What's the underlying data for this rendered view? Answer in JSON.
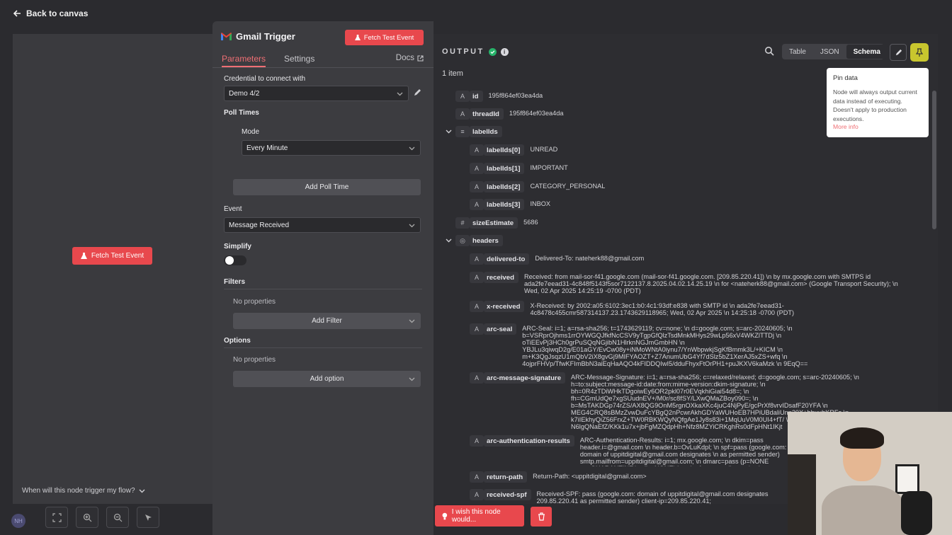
{
  "topbar": {
    "back_label": "Back to canvas"
  },
  "canvas": {
    "fetch_label": "Fetch Test Event",
    "trigger_question": "When will this node trigger my flow?",
    "avatar_initials": "NH"
  },
  "node": {
    "title": "Gmail Trigger",
    "fetch_label": "Fetch Test Event",
    "tabs": [
      {
        "label": "Parameters"
      },
      {
        "label": "Settings"
      }
    ],
    "docs_label": "Docs",
    "credential_label": "Credential to connect with",
    "credential_value": "Demo 4/2",
    "poll_times_label": "Poll Times",
    "mode_label": "Mode",
    "mode_value": "Every Minute",
    "add_poll_label": "Add Poll Time",
    "event_label": "Event",
    "event_value": "Message Received",
    "simplify_label": "Simplify",
    "simplify_on": false,
    "filters_label": "Filters",
    "filters_empty": "No properties",
    "add_filter_label": "Add Filter",
    "options_label": "Options",
    "options_empty": "No properties",
    "add_option_label": "Add option"
  },
  "output": {
    "title": "OUTPUT",
    "item_count": "1 item",
    "view_tabs": [
      {
        "label": "Table"
      },
      {
        "label": "JSON"
      },
      {
        "label": "Schema"
      }
    ],
    "active_view": "Schema",
    "tooltip": {
      "title": "Pin data",
      "body": "Node will always output current data instead of executing. Doesn't apply to production executions.",
      "link": "More info"
    },
    "rows": [
      {
        "type": "A",
        "key": "id",
        "value": "195f864ef03ea4da"
      },
      {
        "type": "A",
        "key": "threadId",
        "value": "195f864ef03ea4da"
      },
      {
        "type": "list",
        "key": "labelIds",
        "value": ""
      },
      {
        "type": "A",
        "key": "labelIds[0]",
        "value": "UNREAD"
      },
      {
        "type": "A",
        "key": "labelIds[1]",
        "value": "IMPORTANT"
      },
      {
        "type": "A",
        "key": "labelIds[2]",
        "value": "CATEGORY_PERSONAL"
      },
      {
        "type": "A",
        "key": "labelIds[3]",
        "value": "INBOX"
      },
      {
        "type": "#",
        "key": "sizeEstimate",
        "value": "5686"
      },
      {
        "type": "obj",
        "key": "headers",
        "value": ""
      },
      {
        "type": "A",
        "key": "delivered-to",
        "value": "Delivered-To: nateherk88@gmail.com"
      },
      {
        "type": "A",
        "key": "received",
        "value": "Received: from mail-sor-f41.google.com (mail-sor-f41.google.com. [209.85.220.41]) \\n by mx.google.com with SMTPS id ada2fe7eead31-4c848f5143f5sor7122137.8.2025.04.02.14.25.19 \\n for <nateherk88@gmail.com> (Google Transport Security); \\n Wed, 02 Apr 2025 14:25:19 -0700 (PDT)"
      },
      {
        "type": "A",
        "key": "x-received",
        "value": "X-Received: by 2002:a05:6102:3ec1:b0:4c1:93df:e838 with SMTP id \\n ada2fe7eead31-4c8478c455cmr587314137.23.1743629118965; Wed, 02 Apr 2025 \\n 14:25:18 -0700 (PDT)"
      },
      {
        "type": "A",
        "key": "arc-seal",
        "value": "ARC-Seal: i=1; a=rsa-sha256; t=1743629119; cv=none; \\n d=google.com; s=arc-20240605; \\n b=VSRprOjhms1rrOYWGQJfkfNcCSV9yTgpGfQlzTsdMnkMHys29wLp56xV4WKZlTTDj \\n oTiEEvPj3HCh0grPuSQqNGjibN1HlrknNGJmGmbHN \\n YBJLu3qiwqD2g/E01aGY/EvCw08y+iNMoWNtA0iynu7/YnWbpwkjSgKfBmmk3L/+KICM \\n m+K3QgJsqzU1mQbV2iX8gvGj9MIFYAOZT+Z7AnumUbG4Yf7dSlz5bZ1XerAJ5xZS+wfq \\n 4ojprFHVp/TfwKFImBbN3aiEqHaAQO4kFIDDQIwI5/dduFhyxFtOrPH1+puJKXV6kaMzk \\n 9EqQ=="
      },
      {
        "type": "A",
        "key": "arc-message-signature",
        "value": "ARC-Message-Signature: i=1; a=rsa-sha256; c=relaxed/relaxed; d=google.com; s=arc-20240605; \\n h=to:subject:message-id:date:from:mime-version:dkim-signature; \\n bh=0R4zTDiWHkTDgoiwEy6OR2pkl07r0EVqkhiGiai54d8=; \\n fh=CGmUdQe7xgSUudnEV+/M0r/sc8fSY/LXwQMaZBoy090=; \\n b=MsTAKDGp74rZS/AX8QG9OnM5rgnOXkaXKc4juC4NjPyE/gcPrXf8vrvIDsafF20YFA \\n MEG4CRQ8sBMzZvwDuFcYBgQ2nPcwrAkhGDYaWUHoEB7HPiUBdaliUnn20X+bhuubKRFs \\n k7iIEkhyQiZ56FrxZ+TW0RBKWQyNQfgAe1Jy8s83i+1MqUuV0M0UI4+fT/ \\n N6lgQNaEfZ/KKk1u7x+jbFgMZQdpHh+Nfz8MZYiCRKghRs0dFpHNt1IKjt"
      },
      {
        "type": "A",
        "key": "arc-authentication-results",
        "value": "ARC-Authentication-Results: i=1; mx.google.com; \\n dkim=pass header.i=@gmail.com \\n header.b=OvLuKdpl; \\n spf=pass (google.com: domain of uppitdigital@gmail.com designates \\n as permitted sender) smtp.mailfrom=uppitdigital@gmail.com; \\n dmarc=pass (p=NONE sp=QUARANTINE \\n dis=NONE) header.from=gmail.com; \\n dara=pass header.i=@gmail.com"
      },
      {
        "type": "A",
        "key": "return-path",
        "value": "Return-Path: <uppitdigital@gmail.com>"
      },
      {
        "type": "A",
        "key": "received-spf",
        "value": "Received-SPF: pass (google.com: domain of uppitdigital@gmail.com designates 209.85.220.41 as permitted sender) client-ip=209.85.220.41;"
      }
    ],
    "wish_label": "I wish this node would..."
  },
  "colors": {
    "accent": "#e8484d",
    "success": "#27b36a",
    "pin": "#c8c62e"
  }
}
